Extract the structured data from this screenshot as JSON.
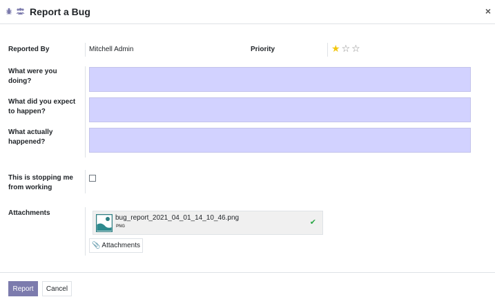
{
  "dialog": {
    "title": "Report a Bug",
    "close_symbol": "×",
    "header_icons": [
      "bug-icon",
      "users-icon"
    ]
  },
  "form": {
    "reported_by": {
      "label": "Reported By",
      "value": "Mitchell Admin"
    },
    "priority": {
      "label": "Priority",
      "stars_filled": 1,
      "stars_total": 3,
      "filled_star": "★",
      "empty_star": "☆"
    },
    "doing": {
      "label_line1": "What were you",
      "label_line2": "doing?",
      "value": ""
    },
    "expected": {
      "label_line1": "What did you expect",
      "label_line2": "to happen?",
      "value": ""
    },
    "actual": {
      "label_line1": "What actually",
      "label_line2": "happened?",
      "value": ""
    },
    "stopping": {
      "label_line1": "This is stopping me",
      "label_line2": "from working",
      "checked": false
    },
    "attachments": {
      "label": "Attachments",
      "file_name": "bug_report_2021_04_01_14_10_46.png",
      "file_type": "PNG",
      "button_label": "Attachments"
    }
  },
  "footer": {
    "report_label": "Report",
    "cancel_label": "Cancel"
  },
  "colors": {
    "primary": "#7c7bad",
    "input_bg": "#d2d2ff",
    "star": "#f3c70f",
    "success": "#28a745"
  }
}
